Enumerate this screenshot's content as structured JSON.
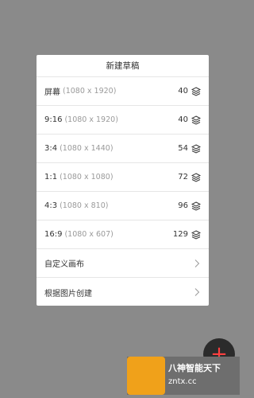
{
  "dialog": {
    "title": "新建草稿",
    "presets": [
      {
        "name": "屏幕",
        "resolution": "(1080 x 1920)",
        "count": "40"
      },
      {
        "name": "9:16",
        "resolution": "(1080 x 1920)",
        "count": "40"
      },
      {
        "name": "3:4",
        "resolution": "(1080 x 1440)",
        "count": "54"
      },
      {
        "name": "1:1",
        "resolution": "(1080 x 1080)",
        "count": "72"
      },
      {
        "name": "4:3",
        "resolution": "(1080 x 810)",
        "count": "96"
      },
      {
        "name": "16:9",
        "resolution": "(1080 x 607)",
        "count": "129"
      }
    ],
    "actions": [
      {
        "label": "自定义画布"
      },
      {
        "label": "根据图片创建"
      }
    ]
  },
  "watermark": {
    "title": "八神智能天下",
    "url": "zntx.cc"
  },
  "fab": {
    "icon": "plus-icon"
  },
  "colors": {
    "backdrop": "#8a8a8a",
    "dialog_bg": "#ffffff",
    "muted_text": "#9a9a9a"
  }
}
